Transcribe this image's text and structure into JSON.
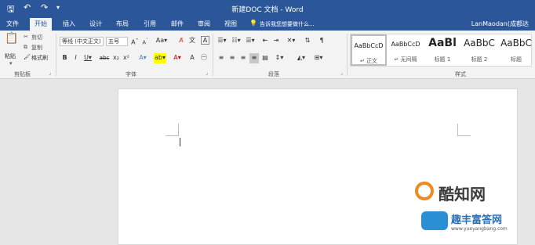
{
  "app": {
    "title": "新建DOC 文档 - Word",
    "user": "LanMaodan(成都达"
  },
  "quick_access": {
    "save_icon": "save-icon",
    "undo_icon": "undo-icon",
    "redo_icon": "redo-icon",
    "customize_icon": "customize-icon"
  },
  "tabs": [
    "文件",
    "开始",
    "插入",
    "设计",
    "布局",
    "引用",
    "邮件",
    "审阅",
    "视图"
  ],
  "tell_me": "告诉我您想要做什么...",
  "clipboard": {
    "paste": "粘贴",
    "cut": "剪切",
    "copy": "复制",
    "format_painter": "格式刷",
    "group_label": "剪贴板"
  },
  "font": {
    "name": "等线 (中文正文)",
    "size": "五号",
    "group_label": "字体"
  },
  "paragraph": {
    "group_label": "段落"
  },
  "styles": {
    "items": [
      {
        "preview": "AaBbCcD",
        "name": "↵ 正文"
      },
      {
        "preview": "AaBbCcD",
        "name": "↵ 无间隔"
      },
      {
        "preview": "AaBl",
        "name": "标题 1"
      },
      {
        "preview": "AaBbC",
        "name": "标题 2"
      },
      {
        "preview": "AaBbC",
        "name": "标题"
      }
    ],
    "group_label": "样式"
  },
  "watermark": {
    "text1": "酷知网",
    "text2": "趣丰富答网",
    "url": "www.yueyangbang.com"
  },
  "colors": {
    "brand": "#2b579a",
    "ribbon": "#f3f3f3",
    "page": "#ffffff"
  }
}
